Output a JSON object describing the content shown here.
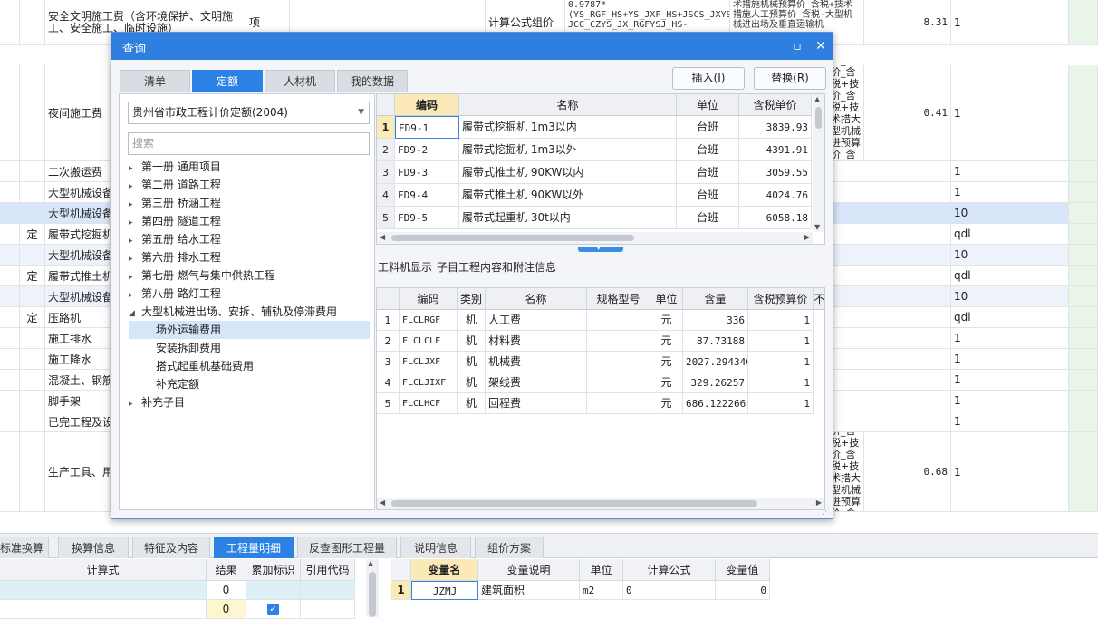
{
  "background": {
    "rows": [
      {
        "name": "安全文明施工费（含环境保护、文明施工、安全施工、临时设施）",
        "unit": "项",
        "calc_method": "计算公式组价",
        "formula": "0.9787*(YS_RGF_HS+YS_JXF_HS+JSCS_JXYSJ_HS+JSCS_RGYSJ_HS-JCC_CZYS_JX_RGFYSJ_HS-",
        "desc": "术措施机械预算价_含税+技术措施人工预算价_含税-大型机械进出场及垂直运输机",
        "rate": "8.31",
        "qty": "1"
      },
      {
        "name": "夜间施工费",
        "desc": "工预算价_含价_含税+技价_含税+技术措大型机械进预算价_含垂直运输机",
        "rate": "0.41",
        "qty": "1"
      },
      {
        "name": "二次搬运费",
        "qty": "1"
      },
      {
        "name": "大型机械设备",
        "qty": "1"
      },
      {
        "name": "大型机械设备",
        "qty": "10"
      },
      {
        "type": "定",
        "name": "履带式挖掘机",
        "qty": "qdl"
      },
      {
        "name": "大型机械设备",
        "qty": "10"
      },
      {
        "type": "定",
        "name": "履带式推土机",
        "qty": "qdl"
      },
      {
        "name": "大型机械设备",
        "qty": "10"
      },
      {
        "type": "定",
        "name": "压路机",
        "qty": "qdl"
      },
      {
        "name": "施工排水",
        "qty": "1"
      },
      {
        "name": "施工降水",
        "qty": "1"
      },
      {
        "name": "混凝土、钢筋",
        "qty": "1"
      },
      {
        "name": "脚手架",
        "qty": "1"
      },
      {
        "name": "已完工程及设",
        "qty": "1"
      },
      {
        "name": "生产工具、用",
        "desc": "工预算价_含价_含税+技价_含税+技术措大型机械进预算价_含垂直运输机",
        "rate": "0.68",
        "qty": "1"
      }
    ]
  },
  "bottom": {
    "tabs": [
      "标准换算",
      "换算信息",
      "特征及内容",
      "工程量明细",
      "反查图形工程量",
      "说明信息",
      "组价方案"
    ],
    "active_tab": "工程量明细",
    "left_headers": [
      "计算式",
      "结果",
      "累加标识",
      "引用代码"
    ],
    "left_rows": [
      {
        "result": "0"
      },
      {
        "result": "0",
        "checked": "✓"
      }
    ],
    "right_headers": [
      "变量名",
      "变量说明",
      "单位",
      "计算公式",
      "变量值"
    ],
    "right_rows": [
      {
        "idx": "1",
        "var": "JZMJ",
        "desc": "建筑面积",
        "unit": "m2",
        "formula": "0",
        "value": "0"
      }
    ]
  },
  "dialog": {
    "title": "查询",
    "tabs": [
      "清单",
      "定额",
      "人材机",
      "我的数据"
    ],
    "active_tab": "定额",
    "insert_button": "插入(I)",
    "replace_button": "替换(R)",
    "library_select": "贵州省市政工程计价定额(2004)",
    "search_placeholder": "搜索",
    "tree": [
      {
        "label": "第一册 通用项目",
        "tw": "▸"
      },
      {
        "label": "第二册 道路工程",
        "tw": "▸"
      },
      {
        "label": "第三册 桥涵工程",
        "tw": "▸"
      },
      {
        "label": "第四册 隧道工程",
        "tw": "▸"
      },
      {
        "label": "第五册 给水工程",
        "tw": "▸"
      },
      {
        "label": "第六册 排水工程",
        "tw": "▸"
      },
      {
        "label": "第七册 燃气与集中供热工程",
        "tw": "▸"
      },
      {
        "label": "第八册 路灯工程",
        "tw": "▸"
      },
      {
        "label": "大型机械进出场、安拆、辅轨及停滞费用",
        "tw": "◢"
      },
      {
        "label": "场外运输费用",
        "tw": ""
      },
      {
        "label": "安装拆卸费用",
        "tw": ""
      },
      {
        "label": "搭式起重机基础费用",
        "tw": ""
      },
      {
        "label": "补充定额",
        "tw": ""
      },
      {
        "label": "补充子目",
        "tw": "▸"
      }
    ],
    "grid_headers": [
      "编码",
      "名称",
      "单位",
      "含税单价"
    ],
    "grid_rows": [
      {
        "idx": "1",
        "code": "FD9-1",
        "name": "履带式挖掘机 1m3以内",
        "unit": "台班",
        "price": "3839.93"
      },
      {
        "idx": "2",
        "code": "FD9-2",
        "name": "履带式挖掘机 1m3以外",
        "unit": "台班",
        "price": "4391.91"
      },
      {
        "idx": "3",
        "code": "FD9-3",
        "name": "履带式推土机 90KW以内",
        "unit": "台班",
        "price": "3059.55"
      },
      {
        "idx": "4",
        "code": "FD9-4",
        "name": "履带式推土机 90KW以外",
        "unit": "台班",
        "price": "4024.76"
      },
      {
        "idx": "5",
        "code": "FD9-5",
        "name": "履带式起重机 30t以内",
        "unit": "台班",
        "price": "6058.18"
      }
    ],
    "subtabs": [
      "工料机显示",
      "子目工程内容和附注信息"
    ],
    "sub_headers": [
      "编码",
      "类别",
      "名称",
      "规格型号",
      "单位",
      "含量",
      "含税预算价",
      "不"
    ],
    "sub_rows": [
      {
        "idx": "1",
        "code": "FLCLRGF",
        "cat": "机",
        "name": "人工费",
        "spec": "",
        "unit": "元",
        "qty": "336",
        "price": "1"
      },
      {
        "idx": "2",
        "code": "FLCLCLF",
        "cat": "机",
        "name": "材料费",
        "spec": "",
        "unit": "元",
        "qty": "87.73188",
        "price": "1"
      },
      {
        "idx": "3",
        "code": "FLCLJXF",
        "cat": "机",
        "name": "机械费",
        "spec": "",
        "unit": "元",
        "qty": "2027.294346",
        "price": "1"
      },
      {
        "idx": "4",
        "code": "FLCLJIXF",
        "cat": "机",
        "name": "架线费",
        "spec": "",
        "unit": "元",
        "qty": "329.26257",
        "price": "1"
      },
      {
        "idx": "5",
        "code": "FLCLHCF",
        "cat": "机",
        "name": "回程费",
        "spec": "",
        "unit": "元",
        "qty": "686.122266",
        "price": "1"
      }
    ]
  }
}
